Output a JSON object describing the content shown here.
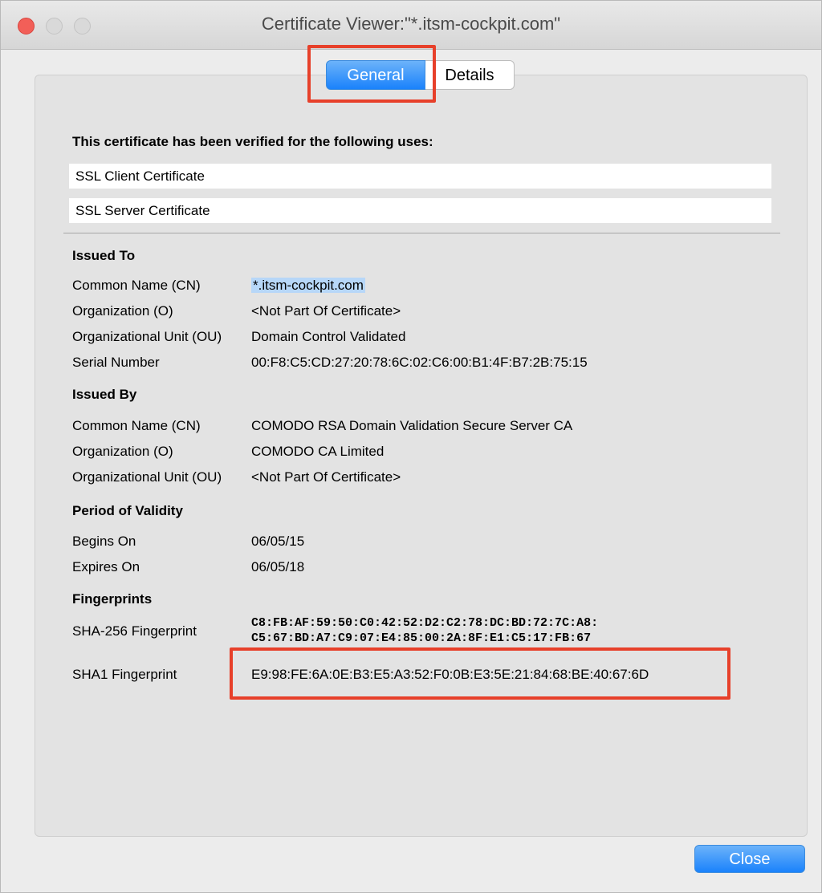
{
  "window": {
    "title": "Certificate Viewer:\"*.itsm-cockpit.com\""
  },
  "tabs": [
    {
      "label": "General"
    },
    {
      "label": "Details"
    }
  ],
  "verified": {
    "heading": "This certificate has been verified for the following uses:",
    "uses": [
      "SSL Client Certificate",
      "SSL Server Certificate"
    ]
  },
  "issued_to": {
    "heading": "Issued To",
    "cn_label": "Common Name (CN)",
    "cn_value": "*.itsm-cockpit.com",
    "o_label": "Organization (O)",
    "o_value": "<Not Part Of Certificate>",
    "ou_label": "Organizational Unit (OU)",
    "ou_value": "Domain Control Validated",
    "serial_label": "Serial Number",
    "serial_value": "00:F8:C5:CD:27:20:78:6C:02:C6:00:B1:4F:B7:2B:75:15"
  },
  "issued_by": {
    "heading": "Issued By",
    "cn_label": "Common Name (CN)",
    "cn_value": "COMODO RSA Domain Validation Secure Server CA",
    "o_label": "Organization (O)",
    "o_value": "COMODO CA Limited",
    "ou_label": "Organizational Unit (OU)",
    "ou_value": "<Not Part Of Certificate>"
  },
  "validity": {
    "heading": "Period of Validity",
    "begins_label": "Begins On",
    "begins_value": "06/05/15",
    "expires_label": "Expires On",
    "expires_value": "06/05/18"
  },
  "fingerprints": {
    "heading": "Fingerprints",
    "sha256_label": "SHA-256 Fingerprint",
    "sha256_line1": "C8:FB:AF:59:50:C0:42:52:D2:C2:78:DC:BD:72:7C:A8:",
    "sha256_line2": "C5:67:BD:A7:C9:07:E4:85:00:2A:8F:E1:C5:17:FB:67",
    "sha1_label": "SHA1 Fingerprint",
    "sha1_value": "E9:98:FE:6A:0E:B3:E5:A3:52:F0:0B:E3:5E:21:84:68:BE:40:67:6D"
  },
  "buttons": {
    "close": "Close"
  },
  "colors": {
    "accent": "#1a82fb",
    "highlight": "#e7402a",
    "selection": "#b7d7f8"
  }
}
